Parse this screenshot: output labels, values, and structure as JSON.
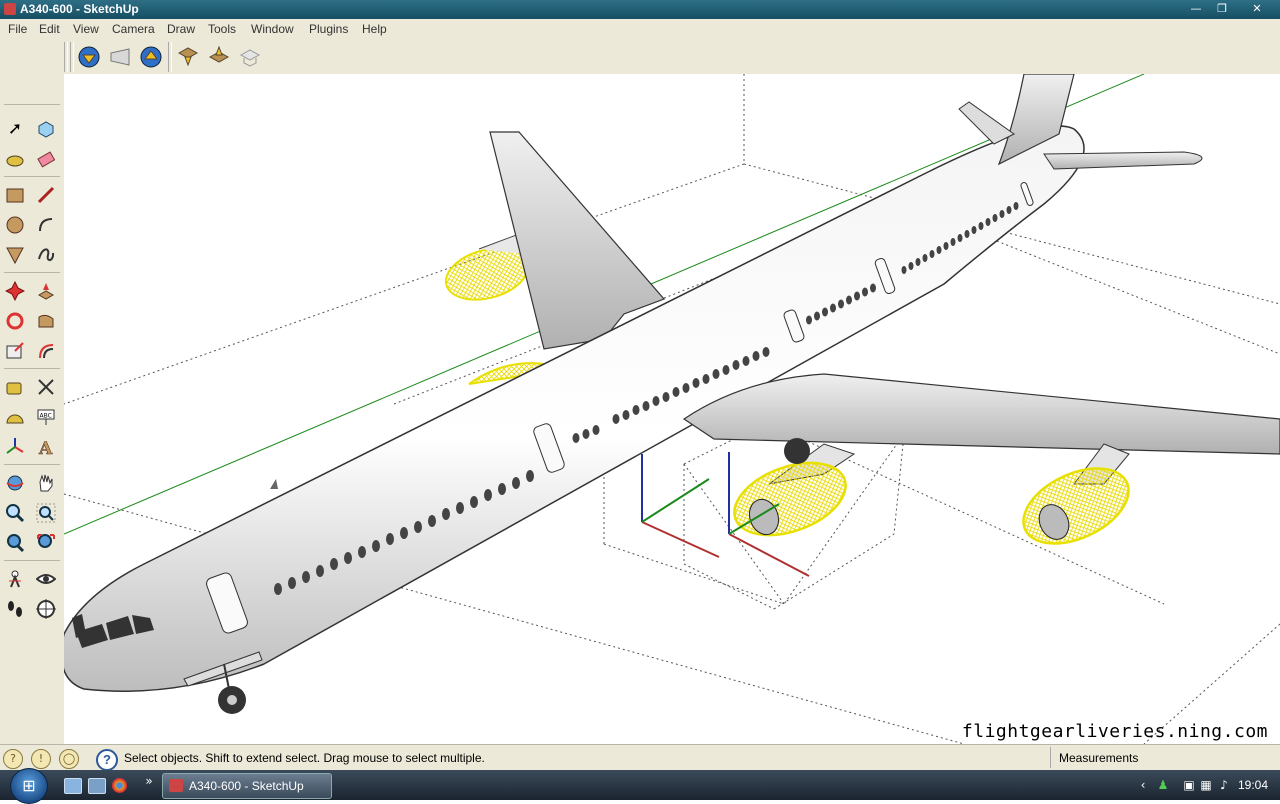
{
  "window": {
    "title": "A340-600 - SketchUp",
    "controls": [
      "—",
      "❐",
      "✕"
    ]
  },
  "menu": [
    "File",
    "Edit",
    "View",
    "Camera",
    "Draw",
    "Tools",
    "Window",
    "Plugins",
    "Help"
  ],
  "toolbar": {
    "icons": [
      "get-models-icon",
      "share-model-icon",
      "share-component-icon",
      "get-photo-texture-icon",
      "upload-icon",
      "preview-icon"
    ]
  },
  "tools": {
    "items": [
      "select-icon",
      "make-component-icon",
      "paint-bucket-icon",
      "eraser-icon",
      "rectangle-icon",
      "line-icon",
      "circle-icon",
      "arc-icon",
      "polygon-icon",
      "freehand-icon",
      "move-icon",
      "push-pull-icon",
      "rotate-icon",
      "follow-me-icon",
      "scale-icon",
      "offset-icon",
      "tape-measure-icon",
      "dimension-icon",
      "protractor-icon",
      "text-icon",
      "axes-icon",
      "3d-text-icon",
      "orbit-icon",
      "pan-icon",
      "zoom-icon",
      "zoom-window-icon",
      "previous-view-icon",
      "zoom-extents-icon",
      "position-camera-icon",
      "look-around-icon",
      "walk-icon",
      "section-plane-icon"
    ]
  },
  "viewport": {
    "watermark": "flightgearliveries.ning.com",
    "model": "A340-600"
  },
  "status": {
    "text": "Select objects. Shift to extend select. Drag mouse to select multiple.",
    "measurements_label": "Measurements"
  },
  "taskbar": {
    "task_label": "A340-600 - SketchUp",
    "clock": "19:04",
    "chevron": "»",
    "tray_chevron": "‹"
  },
  "colors": {
    "axis_green": "#1a8a1a",
    "axis_red": "#b03030",
    "axis_blue": "#2030a0",
    "engine_highlight": "#f4e800",
    "titlebar": "#1e5a70"
  }
}
